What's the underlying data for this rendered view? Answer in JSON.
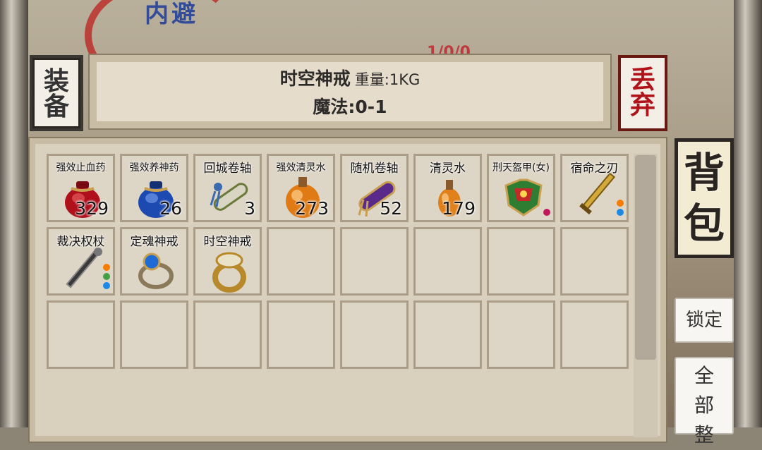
{
  "background": {
    "title_fragment": "内避",
    "status_fragment": "1/0/0"
  },
  "tabs": {
    "equip": [
      "装",
      "备"
    ],
    "discard": [
      "丢",
      "弃"
    ],
    "bag": [
      "背",
      "包"
    ]
  },
  "info": {
    "name": "时空神戒",
    "weight": "重量:1KG",
    "magic": "魔法:0-1"
  },
  "buttons": {
    "lock": "锁定",
    "all": [
      "全",
      "部",
      "整"
    ]
  },
  "items": [
    {
      "name": "强效止血药",
      "count": "329",
      "icon": "red-potion-bag-icon",
      "small": true
    },
    {
      "name": "强效养神药",
      "count": "26",
      "icon": "blue-potion-bag-icon",
      "small": true
    },
    {
      "name": "回城卷轴",
      "count": "3",
      "icon": "town-scroll-icon",
      "small": false
    },
    {
      "name": "强效清灵水",
      "count": "273",
      "icon": "orange-flask-icon",
      "small": true
    },
    {
      "name": "随机卷轴",
      "count": "52",
      "icon": "purple-scroll-icon",
      "small": false
    },
    {
      "name": "清灵水",
      "count": "179",
      "icon": "small-flask-icon",
      "small": false
    },
    {
      "name": "刑天盔甲(女)",
      "count": "",
      "icon": "armor-icon",
      "small": true,
      "dots": [
        "#c2185b"
      ]
    },
    {
      "name": "宿命之刃",
      "count": "",
      "icon": "sword-icon",
      "small": false,
      "dots": [
        "#f57c00",
        "#1e88e5"
      ]
    },
    {
      "name": "裁决权杖",
      "count": "",
      "icon": "scepter-icon",
      "small": false,
      "dots": [
        "#f57c00",
        "#43a047",
        "#1e88e5"
      ]
    },
    {
      "name": "定魂神戒",
      "count": "",
      "icon": "blue-ring-icon",
      "small": false
    },
    {
      "name": "时空神戒",
      "count": "",
      "icon": "gold-ring-icon",
      "small": false
    }
  ],
  "empty_slots": 13
}
